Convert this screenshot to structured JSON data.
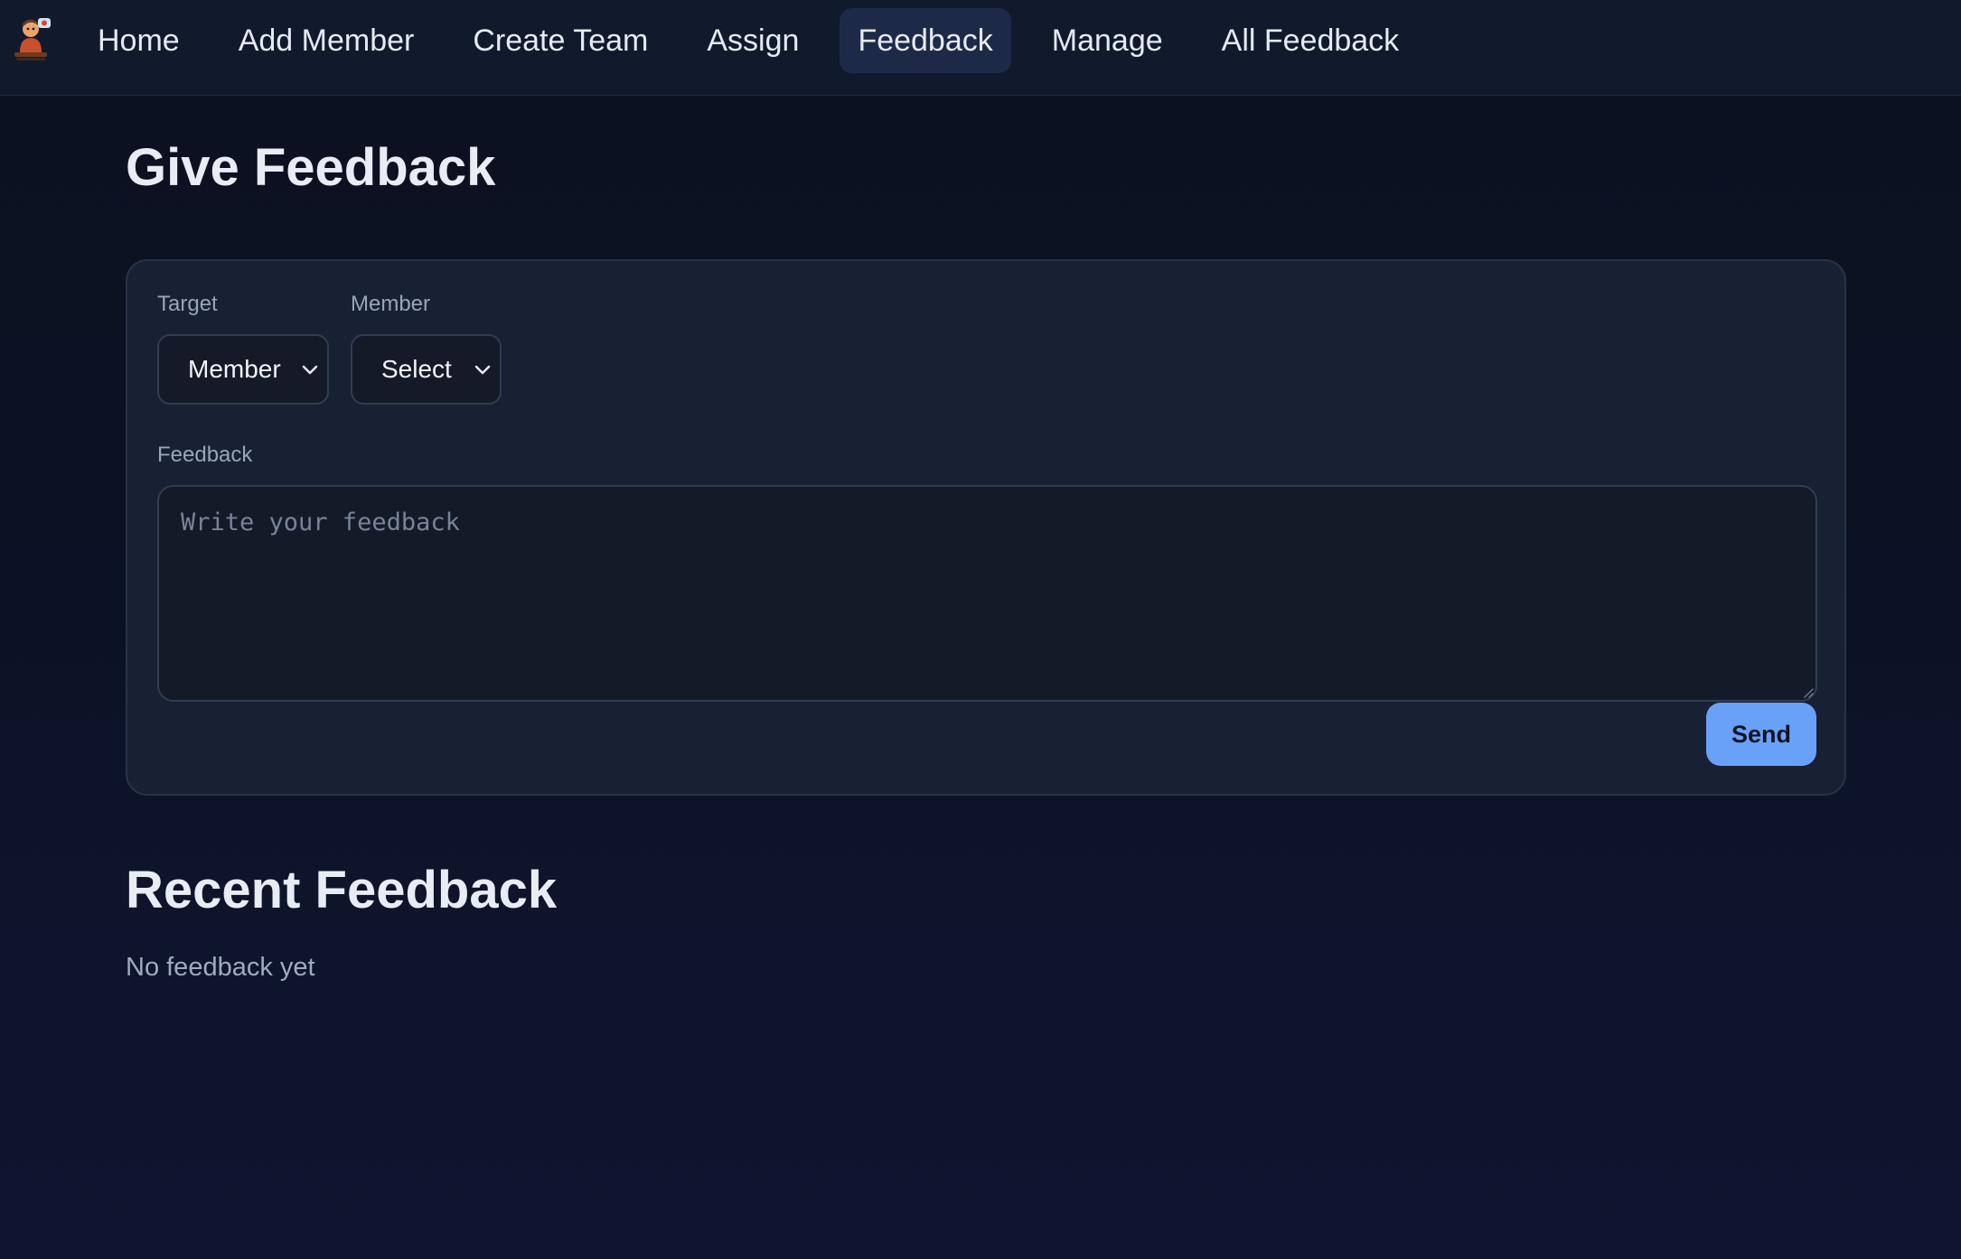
{
  "nav": {
    "logo_icon": "cartoon-avatar-logo-icon",
    "items": [
      {
        "label": "Home",
        "active": false
      },
      {
        "label": "Add Member",
        "active": false
      },
      {
        "label": "Create Team",
        "active": false
      },
      {
        "label": "Assign",
        "active": false
      },
      {
        "label": "Feedback",
        "active": true
      },
      {
        "label": "Manage",
        "active": false
      },
      {
        "label": "All Feedback",
        "active": false
      }
    ]
  },
  "page": {
    "title": "Give Feedback"
  },
  "form": {
    "target_label": "Target",
    "target_value": "Member",
    "member_label": "Member",
    "member_value": "Select",
    "feedback_label": "Feedback",
    "feedback_placeholder": "Write your feedback",
    "send_label": "Send"
  },
  "recent": {
    "title": "Recent Feedback",
    "empty_text": "No feedback yet"
  },
  "colors": {
    "background": "#0b1120",
    "nav_background": "#111a2d",
    "nav_active": "#1d2a47",
    "card_background": "#182033",
    "accent_button": "#6aa1f8"
  }
}
